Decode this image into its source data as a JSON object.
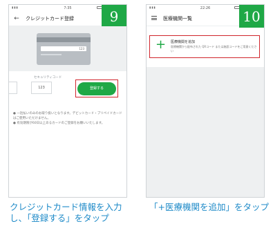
{
  "step9": {
    "badge": "9",
    "status_time": "7:35",
    "title": "クレジットカード登録",
    "card_number_sample": "123",
    "security_label": "セキュリティコード",
    "security_value": "123",
    "register_button": "登録する",
    "notes": [
      "● 一括払いのみのお取り扱いとなります。デビットカード・プリペイドカードはご使用いただけません。",
      "● 有効期限が60日以上あるカードのご登録をお願いいたします。"
    ],
    "caption": "クレジットカード情報を入力し、「登録する」をタップ"
  },
  "step10": {
    "badge": "10",
    "status_time": "22:26",
    "title": "医療機関一覧",
    "add_title": "医療機関を追加",
    "add_desc": "医療機関から配布された QRコード または施設コードをご用意ください",
    "caption": "「+医療機関を追加」をタップ"
  },
  "colors": {
    "accent_green": "#1fa846",
    "highlight_red": "#d0242b",
    "caption_blue": "#1e8ac8"
  }
}
